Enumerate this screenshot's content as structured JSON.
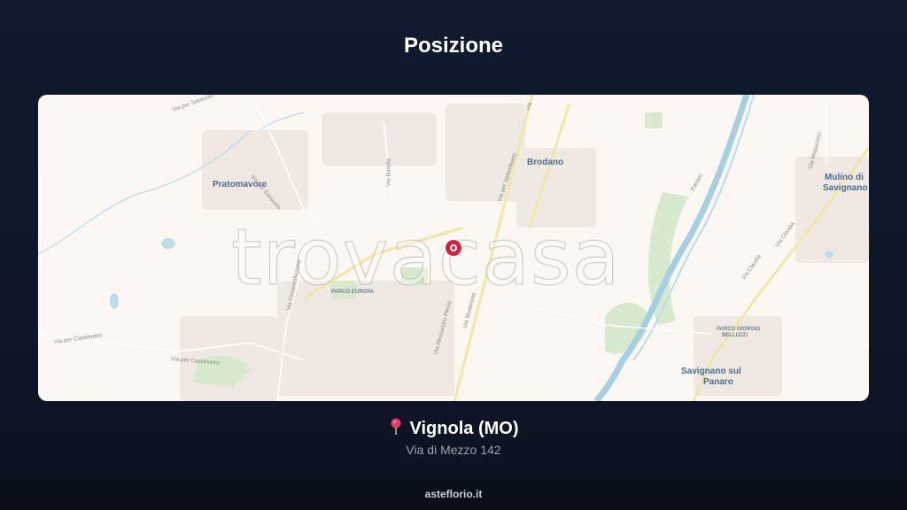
{
  "header": {
    "title": "Posizione"
  },
  "map": {
    "watermark": "trovacasa",
    "places": {
      "pratomavore": "Pratomavore",
      "brodano": "Brodano",
      "mulino_line1": "Mulino di",
      "mulino_line2": "Savignano",
      "savignano_line1": "Savignano sul",
      "savignano_line2": "Panaro",
      "parco_europa": "PARCO EUROPA",
      "parco_giorgio_line1": "PARCO GIORGIO",
      "parco_giorgio_line2": "BELLUZZI"
    },
    "roads": {
      "sassuolo_top": "Via per Sassuolo",
      "sassuolo_mid": "Via per Sassuolo",
      "barella": "Via Barella",
      "spilamberto": "Via per Spilamberto",
      "via_top": "Via",
      "circonvallazione": "Via Circonvallazione",
      "plessi": "Via Alessandro Plessi",
      "modenese": "Via Modenese",
      "castelvetro_1": "Via per Castelvetro",
      "castelvetro_2": "Via per Castelvetro",
      "claudia_1": "Via Claudia",
      "claudia_2": "Via Claudia",
      "magazzino": "Via Magazzino",
      "panaro": "Panaro"
    },
    "colors": {
      "background": "#fcf7f3",
      "marker": "#d8203d",
      "river": "#9ec9dd",
      "park": "#cfe4c3",
      "road": "#f1e7a8"
    }
  },
  "location": {
    "city": "Vignola (MO)",
    "address": "Via di Mezzo 142",
    "pin_icon": "map-pin-icon"
  },
  "footer": {
    "site": "asteflorio.it"
  }
}
